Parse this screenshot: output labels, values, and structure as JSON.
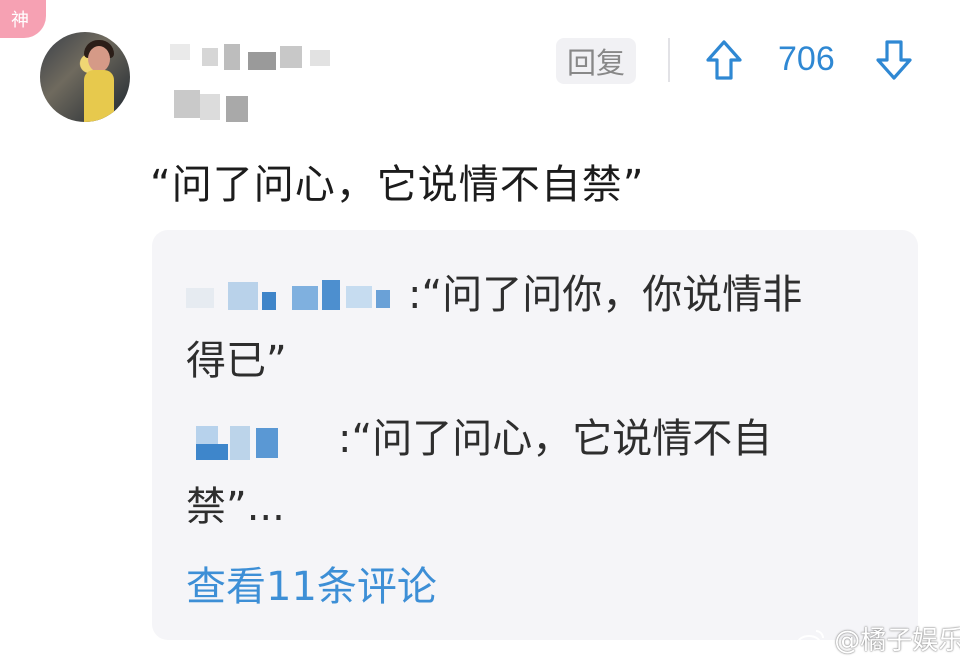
{
  "badge": {
    "label": "神"
  },
  "comment": {
    "text": "“问了问心，它说情不自禁”",
    "reply_label": "回复",
    "votes": "706",
    "icons": {
      "up": "arrow-up-icon",
      "down": "arrow-down-icon"
    }
  },
  "replies": [
    {
      "line1": ":“问了问你，你说情非",
      "line2": "得已”"
    },
    {
      "line1": ":“问了问心，它说情不自",
      "line2": "禁”..."
    }
  ],
  "view_more": "查看11条评论",
  "watermark": {
    "handle": "@橘子娱乐",
    "icon": "weibo-icon"
  },
  "colors": {
    "accent": "#2f88d3",
    "badge": "#f6a1b3"
  }
}
